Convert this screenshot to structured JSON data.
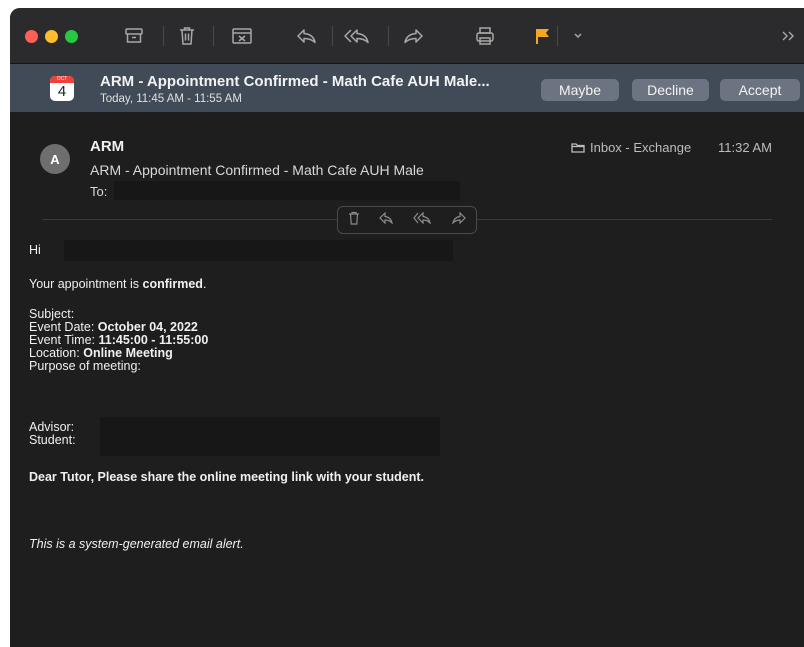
{
  "toolbar": {
    "buttons": [
      "archive-icon",
      "trash-icon",
      "junk-icon",
      "reply-icon",
      "reply-all-icon",
      "forward-icon",
      "print-icon",
      "flag-icon",
      "flag-menu-icon",
      "more-icon"
    ],
    "flag_color": "#f5a623"
  },
  "invitation": {
    "calendar_month": "OCT",
    "calendar_day": "4",
    "title": "ARM - Appointment Confirmed - Math Cafe AUH Male...",
    "time": "Today, 11:45 AM - 11:55 AM",
    "maybe": "Maybe",
    "decline": "Decline",
    "accept": "Accept"
  },
  "message": {
    "avatar_letter": "A",
    "sender": "ARM",
    "subject": "ARM - Appointment Confirmed - Math Cafe AUH Male",
    "to_label": "To:",
    "folder": "Inbox - Exchange",
    "time": "11:32 AM"
  },
  "body": {
    "greeting": "Hi",
    "confirm_prefix": "Your appointment is ",
    "confirm_bold": "confirmed",
    "confirm_suffix": ".",
    "subject_label": "Subject:",
    "event_date_label": "Event Date: ",
    "event_date": "October 04, 2022",
    "event_time_label": "Event Time: ",
    "event_time": "11:45:00 - 11:55:00",
    "location_label": "Location: ",
    "location": "Online Meeting",
    "purpose_label": "Purpose of meeting:",
    "advisor_label": "Advisor:",
    "student_label": "Student:",
    "tutor_note": "Dear Tutor, Please share the online meeting link with your student.",
    "footer": "This is a system-generated email alert."
  },
  "colors": {
    "background": "#1e1e1e",
    "toolbar": "#2b2b2d",
    "invitation_bar": "#414a57",
    "invitation_button": "#6c7481"
  }
}
